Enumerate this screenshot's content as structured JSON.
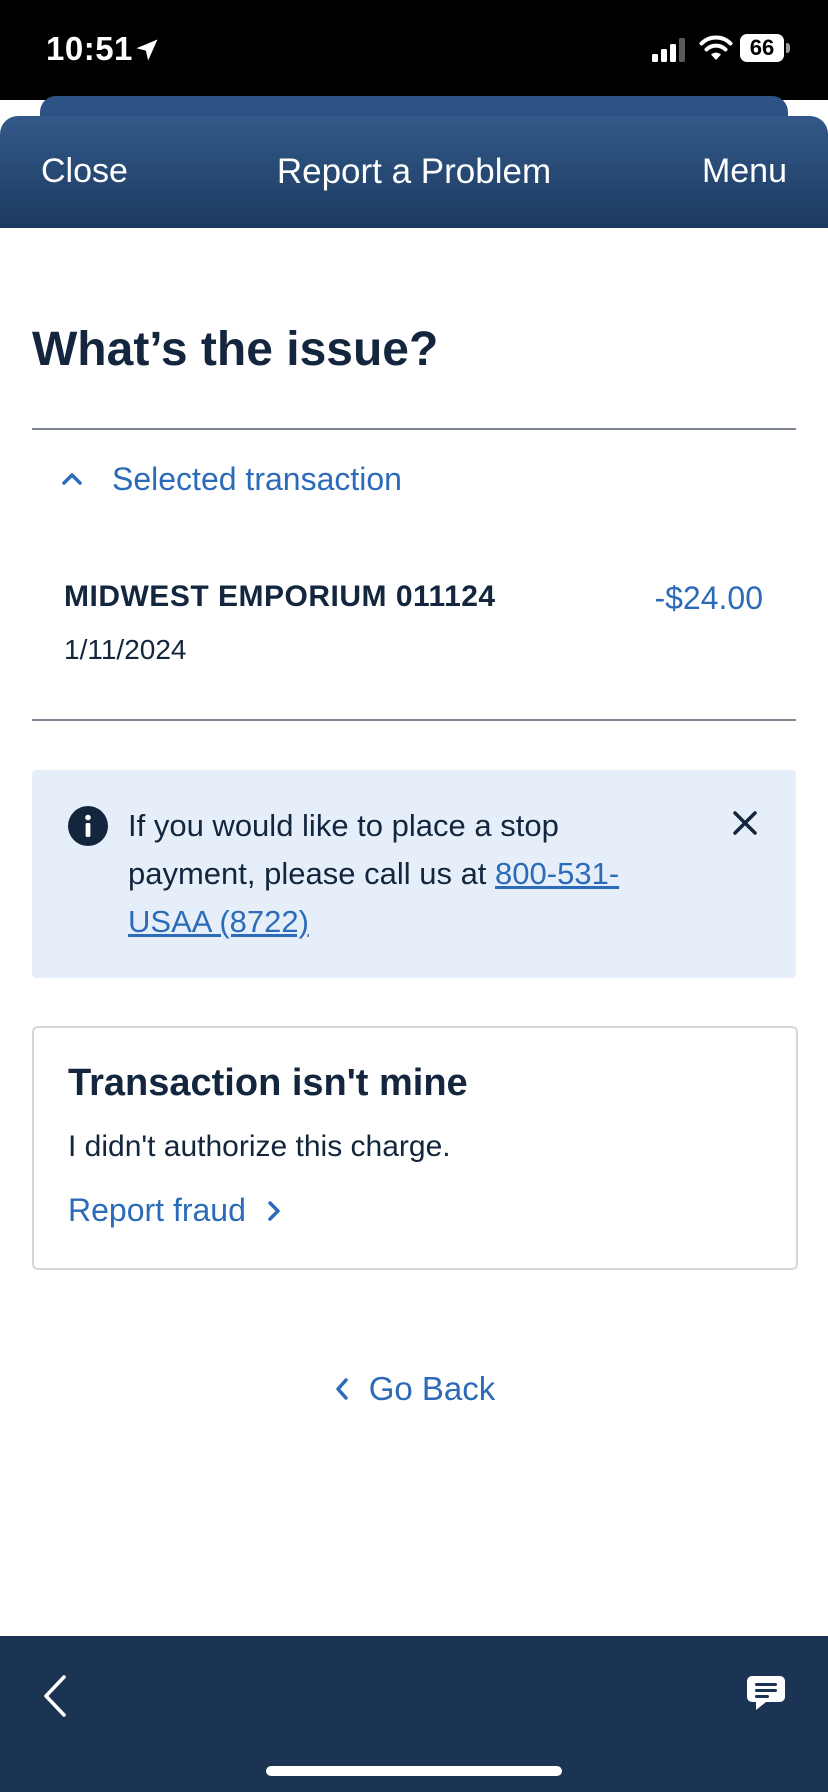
{
  "status_bar": {
    "time": "10:51",
    "battery": "66",
    "icons": [
      "location-arrow-icon",
      "cellular-signal-icon",
      "wifi-icon",
      "battery-icon"
    ]
  },
  "nav": {
    "close_label": "Close",
    "title": "Report a Problem",
    "menu_label": "Menu"
  },
  "page": {
    "title": "What’s the issue?"
  },
  "transaction": {
    "section_label": "Selected transaction",
    "merchant": "MIDWEST EMPORIUM 011124",
    "amount": "-$24.00",
    "date": "1/11/2024"
  },
  "alert": {
    "text": "If you would like to place a stop payment, please call us at ",
    "phone_link": "800-531-USAA (8722)"
  },
  "fraud_card": {
    "title": "Transaction isn't mine",
    "body": "I didn't authorize this charge.",
    "link": "Report fraud"
  },
  "go_back_label": "Go Back",
  "colors": {
    "nav_gradient_top": "#33598a",
    "nav_gradient_bottom": "#1b3a5f",
    "link_blue": "#2c6bb8",
    "text_navy": "#13263e",
    "alert_bg": "#e6eff9",
    "bottom_bar": "#1b3454"
  }
}
